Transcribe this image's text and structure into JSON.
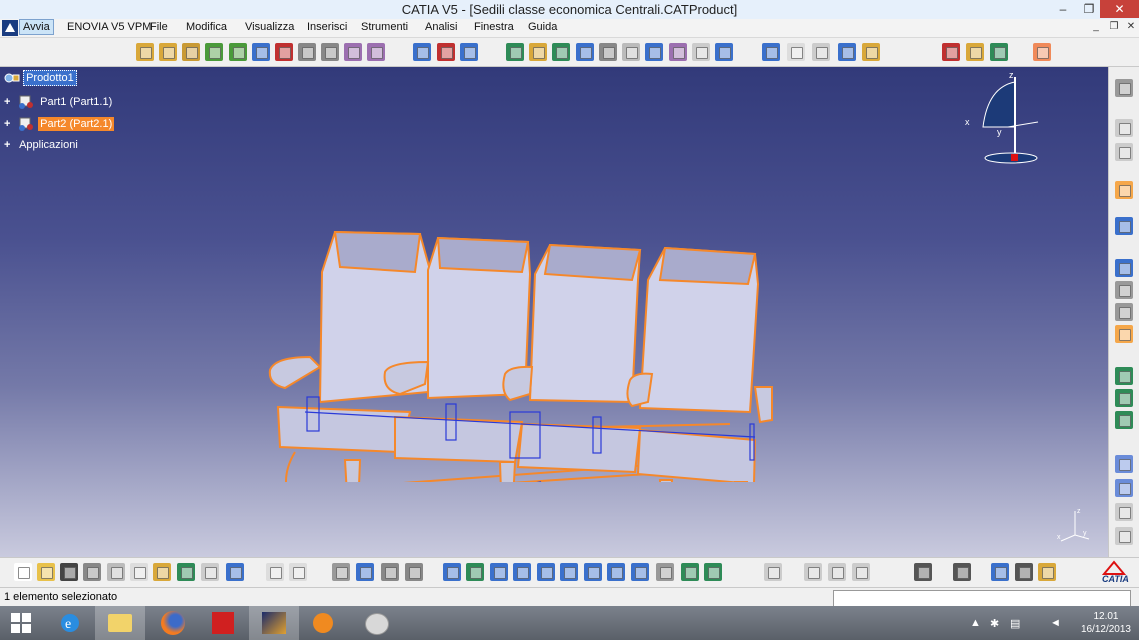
{
  "window": {
    "title": "CATIA V5 - [Sedili classe economica Centrali.CATProduct]",
    "minimize": "–",
    "restore": "❐",
    "close": "✕"
  },
  "menu": {
    "items": [
      "Avvia",
      "ENOVIA V5 VPM",
      "File",
      "Modifica",
      "Visualizza",
      "Inserisci",
      "Strumenti",
      "Analisi",
      "Finestra",
      "Guida"
    ],
    "mdi_minimize": "_",
    "mdi_restore": "❐",
    "mdi_close": "✕"
  },
  "tree": {
    "root": "Prodotto1",
    "part1": "Part1 (Part1.1)",
    "part2": "Part2 (Part2.1)",
    "apps": "Applicazioni"
  },
  "compass": {
    "x": "x",
    "y": "y",
    "z": "z"
  },
  "axis_triad": {
    "x": "x",
    "y": "y",
    "z": "z"
  },
  "status": {
    "text": "1 elemento selezionato",
    "command_value": ""
  },
  "clock": {
    "time": "12.01",
    "date": "16/12/2013"
  },
  "brand": {
    "logo": "CATIA"
  },
  "colors": {
    "viewport_top": "#323a7a",
    "selection_orange": "#f5882b",
    "seat_fill": "#cdd0e6",
    "wire_blue": "#2a3ad8",
    "tree_selected": "#3a70cc"
  },
  "taskbar": {
    "apps": [
      "start-windows-icon",
      "internet-explorer-icon",
      "file-explorer-icon",
      "firefox-icon",
      "acrobat-icon",
      "catia-app-icon",
      "media-player-icon",
      "paint-icon"
    ]
  }
}
